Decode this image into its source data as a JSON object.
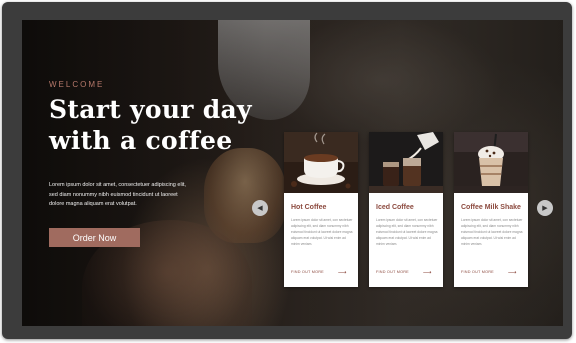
{
  "hero": {
    "eyebrow": "WELCOME",
    "headline": "Start your day with a coffee",
    "intro": "Lorem ipsum dolor sit amet, consectetuer adipiscing elit, sed diam nonummy nibh euismod tincidunt ut laoreet dolore magna aliquam erat volutpat.",
    "order_label": "Order Now"
  },
  "carousel": {
    "prev_icon": "◀",
    "next_icon": "▶"
  },
  "cards": [
    {
      "title": "Hot Coffee",
      "text": "Lorem ipsum dolor sit amet, con sectetuer adipiscing elit, sed diam nonummy nibh euismod tincidunt ut laoreet dolore magna aliquam erat volutpat. Ut wisi enim ad minim veniam.",
      "link_label": "FIND OUT MORE",
      "link_arrow": "⟶"
    },
    {
      "title": "Iced Coffee",
      "text": "Lorem ipsum dolor sit amet, con sectetuer adipiscing elit, sed diam nonummy nibh euismod tincidunt ut laoreet dolore magna aliquam erat volutpat. Ut wisi enim ad minim veniam.",
      "link_label": "FIND OUT MORE",
      "link_arrow": "⟶"
    },
    {
      "title": "Coffee Milk Shake",
      "text": "Lorem ipsum dolor sit amet, con sectetuer adipiscing elit, sed diam nonummy nibh euismod tincidunt ut laoreet dolore magna aliquam erat volutpat. Ut wisi enim ad minim veniam.",
      "link_label": "FIND OUT MORE",
      "link_arrow": "⟶"
    }
  ],
  "colors": {
    "accent": "#a06b5f",
    "title_brown": "#8c4a3f",
    "device_frame": "#3c3c3c"
  }
}
